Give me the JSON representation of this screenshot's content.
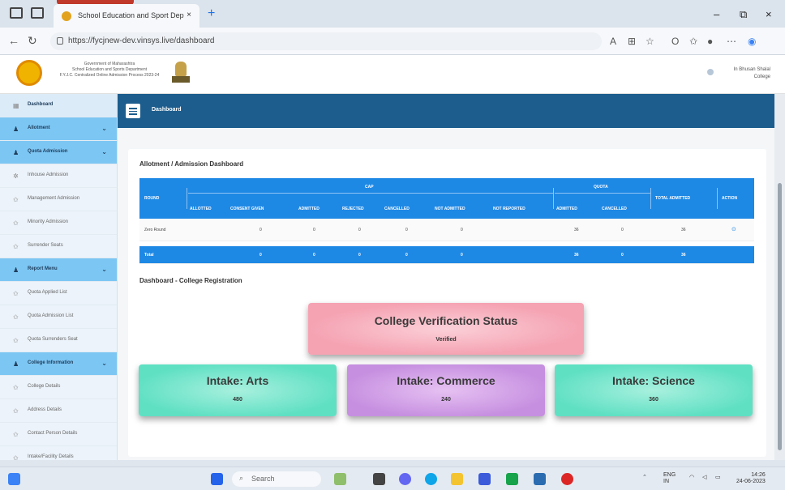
{
  "browser": {
    "tab_title": "School Education and Sport Dep",
    "tab_close": "×",
    "new_tab": "+",
    "url": "https://fycjnew-dev.vinsys.live/dashboard",
    "window_controls": [
      "–",
      "⧉",
      "×"
    ]
  },
  "header": {
    "org_lines": [
      "Government of Maharashtra",
      "School Education and Sports Department",
      "F.Y.J.C. Centralized Online Admission Process 2023-24"
    ],
    "user_name": "In Bhusan Shalal",
    "user_role": "College"
  },
  "sidebar": {
    "items": [
      {
        "label": "Dashboard",
        "type": "active",
        "icon": "dashboard-icon"
      },
      {
        "label": "Allotment",
        "type": "section",
        "icon": "user-icon"
      },
      {
        "label": "Quota Admission",
        "type": "section",
        "icon": "user-icon"
      },
      {
        "label": "Inhouse Admission",
        "type": "item",
        "icon": "gear-icon"
      },
      {
        "label": "Management Admission",
        "type": "item",
        "icon": "star-icon"
      },
      {
        "label": "Minority Admission",
        "type": "item",
        "icon": "star-icon"
      },
      {
        "label": "Surrender Seats",
        "type": "item",
        "icon": "star-icon"
      },
      {
        "label": "Report Menu",
        "type": "section",
        "icon": "user-icon"
      },
      {
        "label": "Quota Applied List",
        "type": "item",
        "icon": "star-icon"
      },
      {
        "label": "Quota Admission List",
        "type": "item",
        "icon": "star-icon"
      },
      {
        "label": "Quota Surrenders Seat",
        "type": "item",
        "icon": "star-icon"
      },
      {
        "label": "College Information",
        "type": "section",
        "icon": "user-icon"
      },
      {
        "label": "College Details",
        "type": "item",
        "icon": "star-icon"
      },
      {
        "label": "Address Details",
        "type": "item",
        "icon": "star-icon"
      },
      {
        "label": "Contact Person Details",
        "type": "item",
        "icon": "star-icon"
      },
      {
        "label": "Intake/Facility Details",
        "type": "item",
        "icon": "star-icon"
      }
    ]
  },
  "topnav": {
    "title": "Dashboard"
  },
  "allotment": {
    "heading": "Allotment / Admission Dashboard",
    "group_cap": "CAP",
    "group_quota": "QUOTA",
    "col_round": "ROUND",
    "col_total_admitted": "TOTAL ADMITTED",
    "col_action": "ACTION",
    "cap_cols": [
      "ALLOTTED",
      "CONSENT GIVEN",
      "ADMITTED",
      "REJECTED",
      "CANCELLED",
      "NOT ADMITTED",
      "NOT REPORTED"
    ],
    "quota_cols": [
      "ADMITTED",
      "CANCELLED"
    ],
    "rows": [
      {
        "round": "Zero Round",
        "cap": [
          "0",
          "0",
          "0",
          "0",
          "0"
        ],
        "quota": [
          "36",
          "0"
        ],
        "total": "36",
        "action": "⊙"
      }
    ],
    "total": {
      "label": "Total",
      "cap": [
        "0",
        "0",
        "0",
        "0",
        "0"
      ],
      "quota": [
        "36",
        "0"
      ],
      "total": "36"
    }
  },
  "registration": {
    "heading": "Dashboard - College Registration",
    "verification": {
      "title": "College Verification Status",
      "value": "Verified"
    },
    "intakes": [
      {
        "title": "Intake: Arts",
        "value": "480"
      },
      {
        "title": "Intake: Commerce",
        "value": "240"
      },
      {
        "title": "Intake: Science",
        "value": "360"
      }
    ]
  },
  "taskbar": {
    "search": "Search",
    "lang": "ENG",
    "lang_sub": "IN",
    "time": "14:26",
    "date": "24-06-2023"
  },
  "colors": {
    "topnav": "#1c5d8d",
    "table_header": "#1e88e5",
    "sidebar_section": "#7cc6f3",
    "verification_bg": "#f5a3b3",
    "arts_bg": "#5fe0c3",
    "commerce_bg": "#c68fe0",
    "science_bg": "#5fe0c3"
  }
}
